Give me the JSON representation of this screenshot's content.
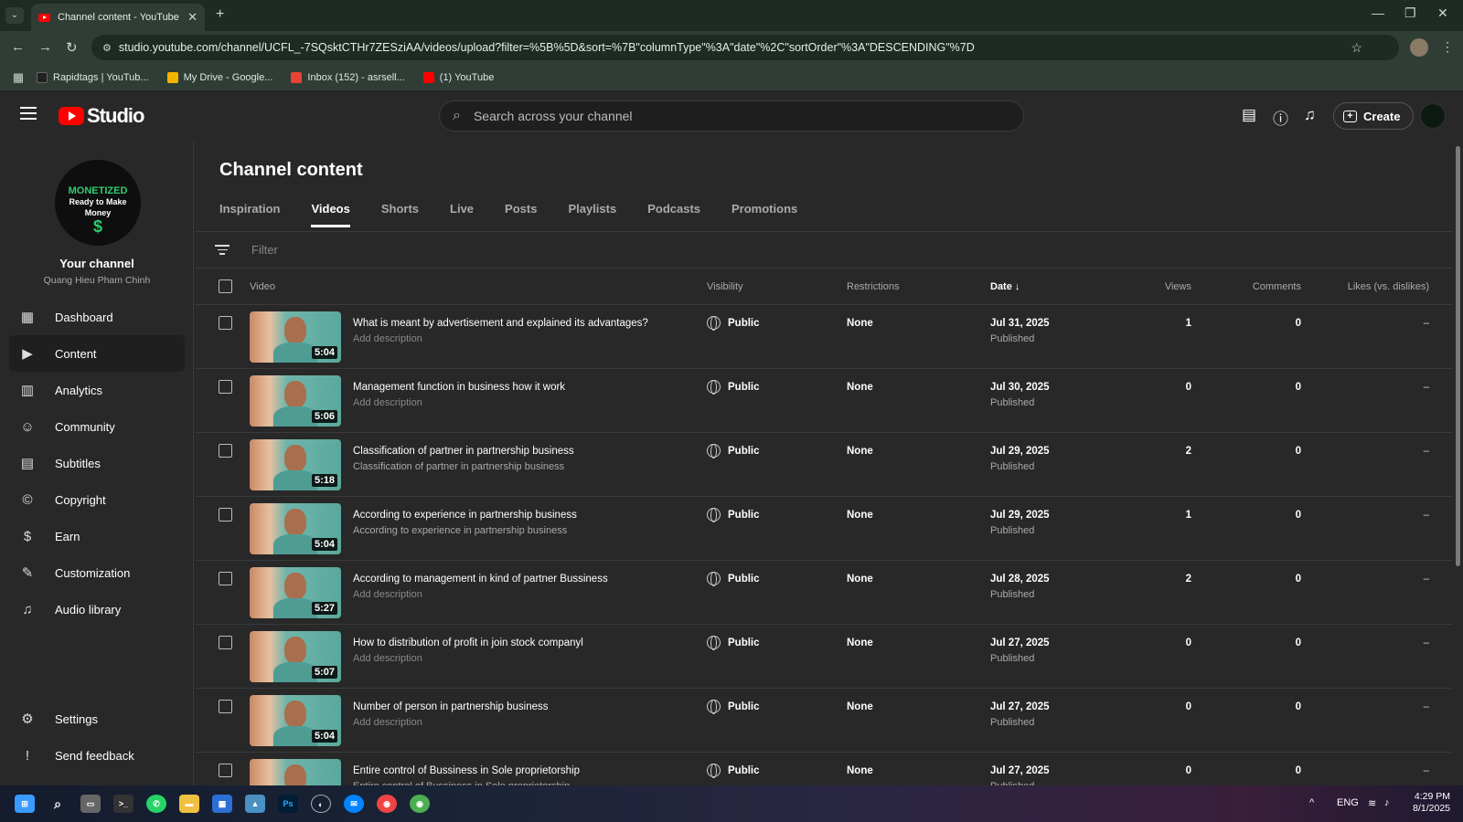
{
  "browser": {
    "tab_title": "Channel content - YouTube Studio",
    "new_tab": "+",
    "url": "studio.youtube.com/channel/UCFL_-7SQsktCTHr7ZESziAA/videos/upload?filter=%5B%5D&sort=%7B\"columnType\"%3A\"date\"%2C\"sortOrder\"%3A\"DESCENDING\"%7D",
    "bookmarks": [
      {
        "label": "Rapidtags | YouTub...",
        "color": "#222222"
      },
      {
        "label": "My Drive - Google...",
        "color": "#f4b400"
      },
      {
        "label": "Inbox (152) - asrsell...",
        "color": "#ea4335"
      },
      {
        "label": "(1) YouTube",
        "color": "#ff0000"
      }
    ]
  },
  "header": {
    "logo_text": "Studio",
    "search_placeholder": "Search across your channel",
    "create_label": "Create"
  },
  "sidebar": {
    "avatar": {
      "line1": "MONETIZED",
      "line2": "Ready to Make",
      "line3": "Money",
      "symbol": "$"
    },
    "channel_title": "Your channel",
    "channel_name": "Quang Hieu Pham Chinh",
    "items": [
      {
        "label": "Dashboard",
        "icon": "▦"
      },
      {
        "label": "Content",
        "icon": "▶"
      },
      {
        "label": "Analytics",
        "icon": "▥"
      },
      {
        "label": "Community",
        "icon": "☺"
      },
      {
        "label": "Subtitles",
        "icon": "▤"
      },
      {
        "label": "Copyright",
        "icon": "©"
      },
      {
        "label": "Earn",
        "icon": "$"
      },
      {
        "label": "Customization",
        "icon": "✎"
      },
      {
        "label": "Audio library",
        "icon": "♫"
      }
    ],
    "bottom": [
      {
        "label": "Settings",
        "icon": "⚙"
      },
      {
        "label": "Send feedback",
        "icon": "!"
      }
    ]
  },
  "main": {
    "title": "Channel content",
    "tabs": [
      "Inspiration",
      "Videos",
      "Shorts",
      "Live",
      "Posts",
      "Playlists",
      "Podcasts",
      "Promotions"
    ],
    "active_tab": "Videos",
    "filter_placeholder": "Filter",
    "columns": {
      "video": "Video",
      "visibility": "Visibility",
      "restrictions": "Restrictions",
      "date": "Date",
      "date_sort": "↓",
      "views": "Views",
      "comments": "Comments",
      "likes": "Likes (vs. dislikes)"
    },
    "rows": [
      {
        "duration": "5:04",
        "title": "What is meant by advertisement and explained its advantages?",
        "description": "Add description",
        "has_desc": false,
        "visibility": "Public",
        "restrictions": "None",
        "date": "Jul 31, 2025",
        "status": "Published",
        "views": "1",
        "comments": "0",
        "likes": "–"
      },
      {
        "duration": "5:06",
        "title": "Management function in business how it work",
        "description": "Add description",
        "has_desc": false,
        "visibility": "Public",
        "restrictions": "None",
        "date": "Jul 30, 2025",
        "status": "Published",
        "views": "0",
        "comments": "0",
        "likes": "–"
      },
      {
        "duration": "5:18",
        "title": "Classification of partner in partnership business",
        "description": "Classification of partner in partnership business",
        "has_desc": true,
        "visibility": "Public",
        "restrictions": "None",
        "date": "Jul 29, 2025",
        "status": "Published",
        "views": "2",
        "comments": "0",
        "likes": "–"
      },
      {
        "duration": "5:04",
        "title": "According to experience in partnership business",
        "description": "According to experience in partnership business",
        "has_desc": true,
        "visibility": "Public",
        "restrictions": "None",
        "date": "Jul 29, 2025",
        "status": "Published",
        "views": "1",
        "comments": "0",
        "likes": "–"
      },
      {
        "duration": "5:27",
        "title": "According to management in kind of partner Bussiness",
        "description": "Add description",
        "has_desc": false,
        "visibility": "Public",
        "restrictions": "None",
        "date": "Jul 28, 2025",
        "status": "Published",
        "views": "2",
        "comments": "0",
        "likes": "–"
      },
      {
        "duration": "5:07",
        "title": "How to distribution of profit in join stock companyl",
        "description": "Add description",
        "has_desc": false,
        "visibility": "Public",
        "restrictions": "None",
        "date": "Jul 27, 2025",
        "status": "Published",
        "views": "0",
        "comments": "0",
        "likes": "–"
      },
      {
        "duration": "5:04",
        "title": "Number of person in partnership business",
        "description": "Add description",
        "has_desc": false,
        "visibility": "Public",
        "restrictions": "None",
        "date": "Jul 27, 2025",
        "status": "Published",
        "views": "0",
        "comments": "0",
        "likes": "–"
      },
      {
        "duration": "",
        "title": "Entire control of Bussiness in Sole proprietorship",
        "description": "Entire control of Bussiness in Sole proprietorship",
        "has_desc": true,
        "visibility": "Public",
        "restrictions": "None",
        "date": "Jul 27, 2025",
        "status": "Published",
        "views": "0",
        "comments": "0",
        "likes": "–"
      }
    ]
  },
  "taskbar": {
    "lang": "ENG",
    "time": "4:29 PM",
    "date": "8/1/2025"
  }
}
